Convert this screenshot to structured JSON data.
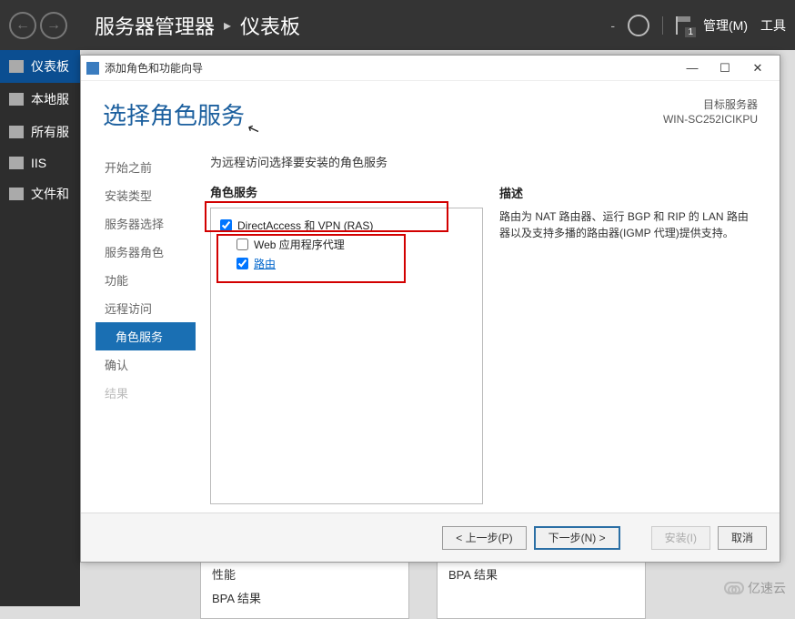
{
  "topbar": {
    "breadcrumb_app": "服务器管理器",
    "breadcrumb_page": "仪表板",
    "manage_label": "管理(M)",
    "tools_label": "工具",
    "flag_count": "1"
  },
  "sidebar": {
    "items": [
      {
        "label": "仪表板"
      },
      {
        "label": "本地服"
      },
      {
        "label": "所有服"
      },
      {
        "label": "IIS"
      },
      {
        "label": "文件和"
      }
    ]
  },
  "wizard": {
    "window_title": "添加角色和功能向导",
    "heading": "选择角色服务",
    "target_label": "目标服务器",
    "target_server": "WIN-SC252ICIKPU",
    "instruction": "为远程访问选择要安装的角色服务",
    "roles_heading": "角色服务",
    "desc_heading": "描述",
    "description": "路由为 NAT 路由器、运行 BGP 和 RIP 的 LAN 路由器以及支持多播的路由器(IGMP 代理)提供支持。",
    "steps": [
      {
        "label": "开始之前"
      },
      {
        "label": "安装类型"
      },
      {
        "label": "服务器选择"
      },
      {
        "label": "服务器角色"
      },
      {
        "label": "功能"
      },
      {
        "label": "远程访问"
      },
      {
        "label": "角色服务"
      },
      {
        "label": "确认"
      },
      {
        "label": "结果"
      }
    ],
    "roles": [
      {
        "label": "DirectAccess 和 VPN (RAS)",
        "checked": true
      },
      {
        "label": "Web 应用程序代理",
        "checked": false
      },
      {
        "label": "路由",
        "checked": true
      }
    ],
    "buttons": {
      "prev": "< 上一步(P)",
      "next": "下一步(N) >",
      "install": "安装(I)",
      "cancel": "取消"
    }
  },
  "bg_panels": {
    "left": [
      "性能",
      "BPA 结果"
    ],
    "right": [
      "BPA 结果"
    ]
  },
  "watermark": "亿速云"
}
